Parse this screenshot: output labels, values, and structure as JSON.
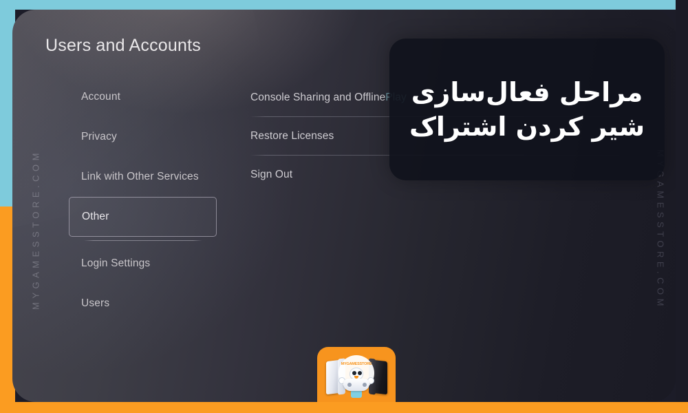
{
  "frame": {
    "accent_cyan": "#7ecbdc",
    "accent_orange": "#fb9c21",
    "panel_dark": "#1b1b26"
  },
  "watermark": {
    "left_text": "MYGAMESSTORE.COM",
    "right_text": "MYGAMESSTORE.COM"
  },
  "console_screen": {
    "page_title": "Users and Accounts",
    "left_menu": [
      {
        "label": "Account",
        "selected": false
      },
      {
        "label": "Privacy",
        "selected": false
      },
      {
        "label": "Link with Other Services",
        "selected": false
      },
      {
        "label": "Other",
        "selected": true
      },
      {
        "label": "Login Settings",
        "selected": false
      },
      {
        "label": "Users",
        "selected": false
      }
    ],
    "right_options": [
      {
        "label": "Console Sharing and Offline ",
        "tinted_label": "Play"
      },
      {
        "label": "Restore Licenses",
        "tinted_label": ""
      },
      {
        "label": "Sign Out",
        "tinted_label": ""
      }
    ]
  },
  "caption_overlay": {
    "line1": "مراحل فعال‌سازی",
    "line2": "شیر کردن اشتراک",
    "background": "#10121c",
    "text_color": "#ffffff"
  },
  "logo_badge": {
    "wordmark": "MYGAMESSTORE",
    "background": "#f7941e"
  }
}
